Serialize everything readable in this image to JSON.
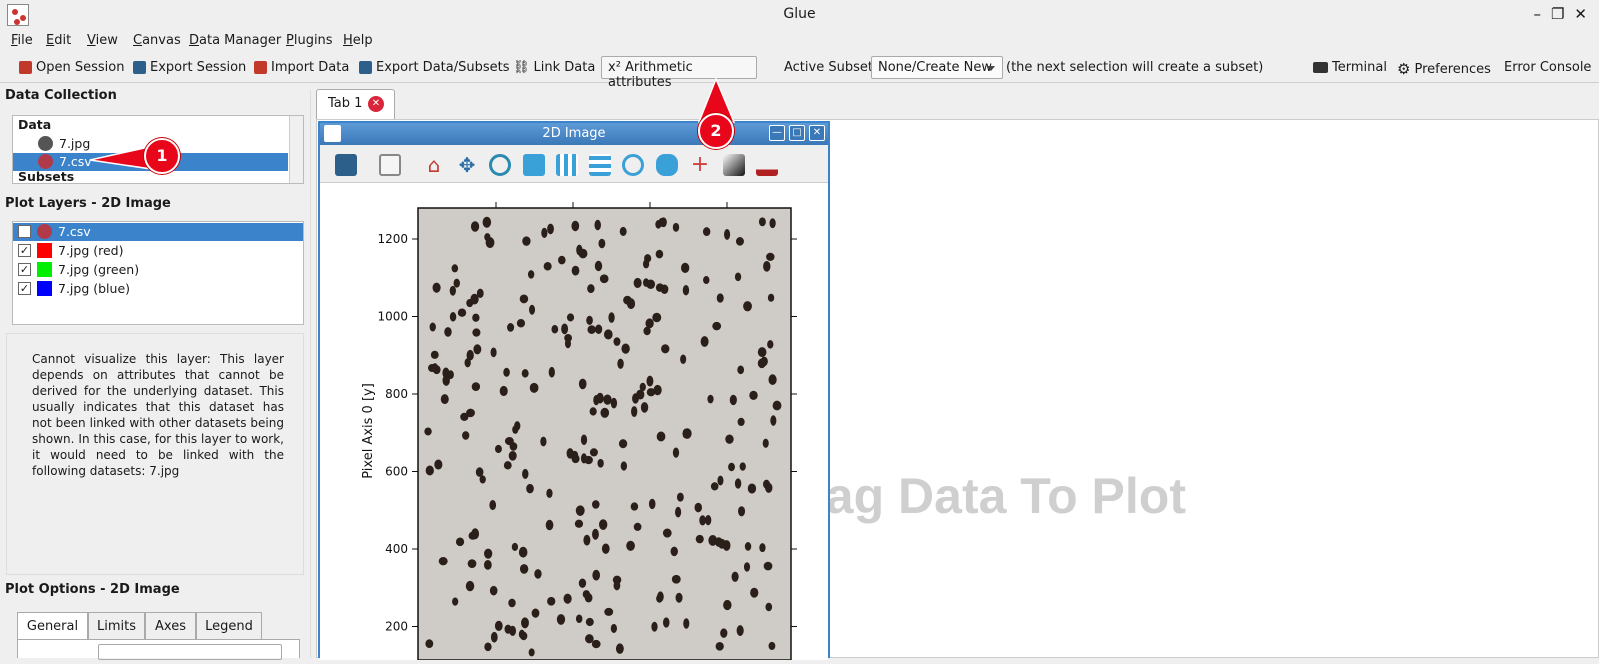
{
  "window": {
    "title": "Glue"
  },
  "menu": [
    "File",
    "Edit",
    "View",
    "Canvas",
    "Data Manager",
    "Plugins",
    "Help"
  ],
  "toolbar": {
    "open_session": "Open Session",
    "export_session": "Export Session",
    "import_data": "Import Data",
    "export_data_subsets": "Export Data/Subsets",
    "link_data": "Link Data",
    "arithmetic": "x² Arithmetic attributes",
    "active_subset_label": "Active Subset:",
    "active_subset_value": "None/Create New",
    "subset_hint": "(the next selection will create a subset)",
    "terminal": "Terminal",
    "preferences": "Preferences",
    "error_console": "Error Console"
  },
  "data_collection": {
    "title": "Data Collection",
    "data_header": "Data",
    "items": [
      {
        "label": "7.jpg",
        "color": "#555555"
      },
      {
        "label": "7.csv",
        "color": "#b03a48"
      }
    ],
    "subsets_header": "Subsets"
  },
  "plot_layers": {
    "title": "Plot Layers - 2D Image",
    "items": [
      {
        "label": "7.csv",
        "color": "#b03a48",
        "checked": false
      },
      {
        "label": "7.jpg (red)",
        "color": "#ff0000",
        "checked": true
      },
      {
        "label": "7.jpg (green)",
        "color": "#00ee00",
        "checked": true
      },
      {
        "label": "7.jpg (blue)",
        "color": "#0000ff",
        "checked": true
      }
    ],
    "check_mark": "✓"
  },
  "notice": "Cannot visualize this layer:  This layer depends on attributes that cannot be derived for the underlying dataset. This usually indicates that this dataset has not been linked with other datasets being shown. In this case, for this layer to work, it would need to be linked with the following datasets: 7.jpg",
  "plot_options": {
    "title": "Plot Options - 2D Image",
    "tabs": [
      "General",
      "Limits",
      "Axes",
      "Legend"
    ]
  },
  "main_tab": {
    "label": "Tab 1",
    "close": "✕"
  },
  "watermark": "Drag Data To Plot",
  "subwindow": {
    "title": "2D Image",
    "ylabel": "Pixel Axis 0 [y]",
    "yticks": [
      "1200",
      "1000",
      "800",
      "600",
      "400",
      "200"
    ],
    "controls": [
      "—",
      "□",
      "✕"
    ]
  },
  "annotations": {
    "one": "1",
    "two": "2"
  },
  "colors": {
    "accent": "#3b84cc",
    "badge": "#e8061b"
  }
}
